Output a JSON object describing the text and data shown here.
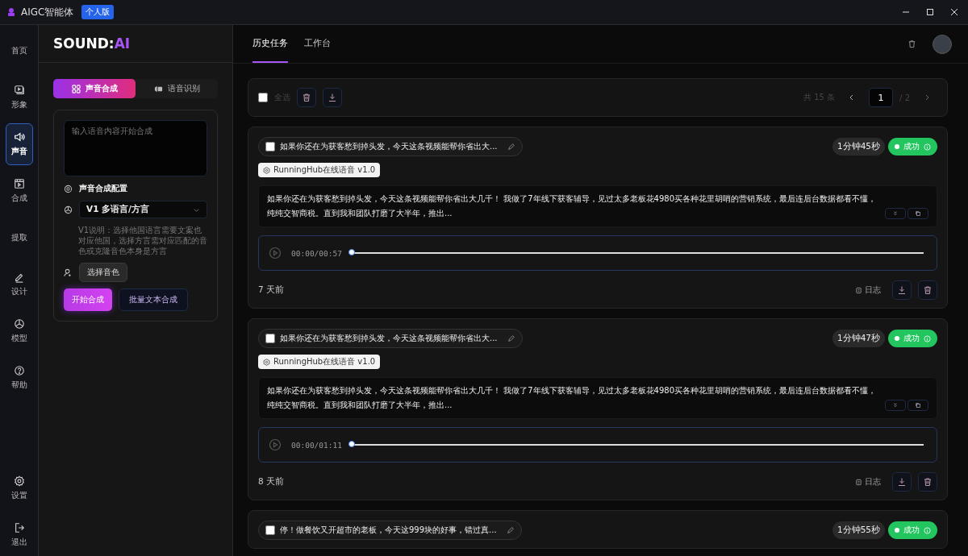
{
  "app": {
    "title": "AIGC智能体",
    "edition": "个人版"
  },
  "nav": [
    {
      "label": "首页",
      "selected": false
    },
    {
      "label": "形象",
      "selected": false
    },
    {
      "label": "声音",
      "selected": true
    },
    {
      "label": "合成",
      "selected": false
    },
    {
      "label": "提取",
      "selected": false
    },
    {
      "label": "设计",
      "selected": false
    },
    {
      "label": "模型",
      "selected": false
    },
    {
      "label": "帮助",
      "selected": false
    },
    {
      "label": "设置",
      "selected": false
    },
    {
      "label": "退出",
      "selected": false
    }
  ],
  "panel": {
    "logo_main": "SOUND:",
    "logo_accent": "AI",
    "mode_tabs": [
      {
        "label": "声音合成",
        "selected": true
      },
      {
        "label": "语音识别",
        "selected": false
      }
    ],
    "text_placeholder": "输入语音内容开始合成",
    "config_title": "声音合成配置",
    "model_select": "V1 多语言/方言",
    "note": "V1说明：选择他国语言需要文案也对应他国，选择方言需对应匹配的音色或克隆音色本身是方言",
    "voice_button": "选择音色",
    "start_button": "开始合成",
    "batch_button": "批量文本合成"
  },
  "main_tabs": [
    {
      "label": "历史任务",
      "selected": true
    },
    {
      "label": "工作台",
      "selected": false
    }
  ],
  "toolbar": {
    "select_all": "全选",
    "select_all_checked": false,
    "total": "共 15 条",
    "page": "1",
    "pages": "/ 2"
  },
  "tasks": [
    {
      "title": "如果你还在为获客愁到掉头发，今天这条视频能帮你省出大...",
      "checked": false,
      "duration": "1分钟45秒",
      "status": "成功",
      "model": "RunningHub在线语音 v1.0",
      "text": "如果你还在为获客愁到掉头发，今天这条视频能帮你省出大几千！ 我做了7年线下获客辅导，见过太多老板花4980买各种花里胡哨的营销系统，最后连后台数据都看不懂，纯纯交智商税。直到我和团队打磨了大半年，推出...",
      "time": "00:00/00:57",
      "level": 0,
      "ago": "7 天前",
      "log": "日志"
    },
    {
      "title": "如果你还在为获客愁到掉头发，今天这条视频能帮你省出大...",
      "checked": false,
      "duration": "1分钟47秒",
      "status": "成功",
      "model": "RunningHub在线语音 v1.0",
      "text": "如果你还在为获客愁到掉头发，今天这条视频能帮你省出大几千！ 我做了7年线下获客辅导，见过太多老板花4980买各种花里胡哨的营销系统，最后连后台数据都看不懂，纯纯交智商税。直到我和团队打磨了大半年，推出...",
      "time": "00:00/01:11",
      "level": 0,
      "ago": "8 天前",
      "log": "日志"
    },
    {
      "title": "停！做餐饮又开超市的老板，今天这999块的好事，错过真...",
      "checked": false,
      "duration": "1分钟55秒",
      "status": "成功"
    }
  ]
}
